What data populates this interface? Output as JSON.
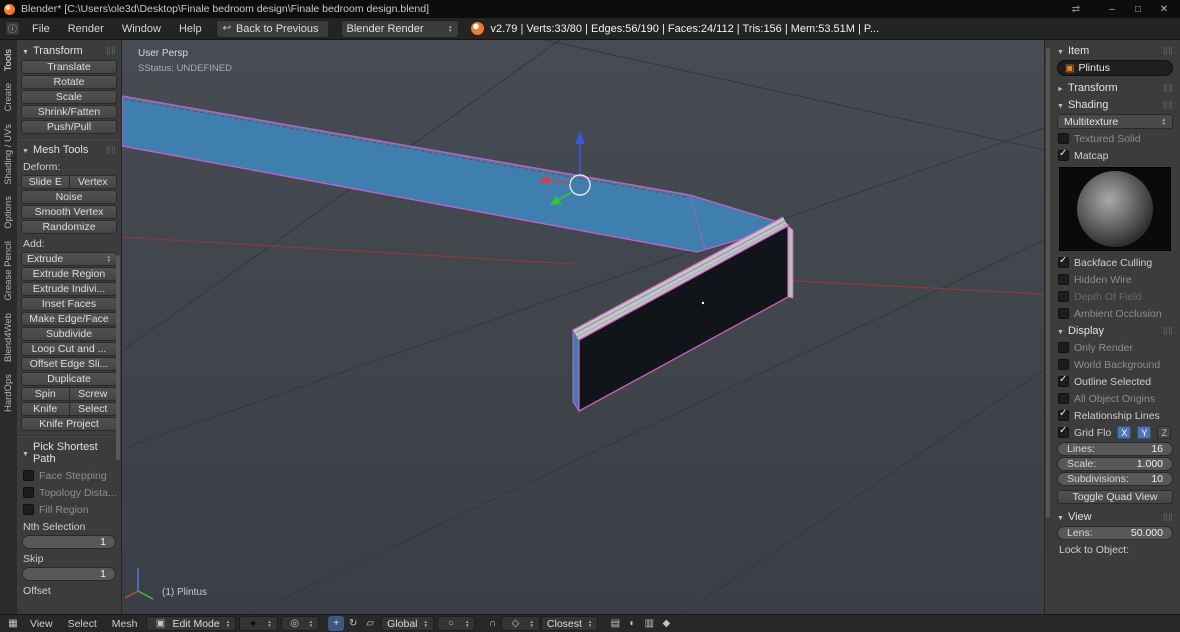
{
  "titlebar": {
    "title": "Blender* [C:\\Users\\ole3d\\Desktop\\Finale bedroom design\\Finale bedroom design.blend]",
    "window_icons": {
      "lang": "⇄",
      "minimize": "–",
      "maximize": "□",
      "close": "✕"
    }
  },
  "menubar": {
    "menus": [
      "File",
      "Render",
      "Window",
      "Help"
    ],
    "back_button": "Back to Previous",
    "engine": "Blender Render",
    "stats": "v2.79 | Verts:33/80 | Edges:56/190 | Faces:24/112 | Tris:156 | Mem:53.51M | P..."
  },
  "icons": {
    "info_editor": "ⓘ",
    "viewport_editor": "▦",
    "back": "↩",
    "mode_cube": "▣",
    "shading_sphere": "●",
    "pivot": "◎",
    "manip_translate": "+",
    "manip_rotate": "↻",
    "manip_scale": "▱",
    "proportional": "○",
    "snap_magnet": "∩",
    "snap_element": "◇",
    "render_a": "▤",
    "render_b": "◐",
    "render_c": "▥",
    "render_d": "◆",
    "object_cube": "▣"
  },
  "toolshelf": {
    "tabs": [
      "Tools",
      "Create",
      "Shading / UVs",
      "Options",
      "Grease Pencil",
      "Blend4Web",
      "HardOps"
    ],
    "transform": {
      "header": "Transform",
      "buttons": [
        "Translate",
        "Rotate",
        "Scale",
        "Shrink/Fatten",
        "Push/Pull"
      ]
    },
    "mesh_tools": {
      "header": "Mesh Tools",
      "deform_label": "Deform:",
      "pair1": [
        "Slide E",
        "Vertex"
      ],
      "buttons1": [
        "Noise",
        "Smooth Vertex",
        "Randomize"
      ],
      "add_label": "Add:",
      "extrude": "Extrude",
      "buttons2": [
        "Extrude Region",
        "Extrude Indivi...",
        "Inset Faces",
        "Make Edge/Face",
        "Subdivide",
        "Loop Cut and ...",
        "Offset Edge Sli...",
        "Duplicate"
      ],
      "pair2": [
        "Spin",
        "Screw"
      ],
      "pair3": [
        "Knife",
        "Select"
      ],
      "knife_project": "Knife Project"
    },
    "pick": {
      "header": "Pick Shortest Path",
      "checks": [
        "Face Stepping",
        "Topology Dista...",
        "Fill Region"
      ],
      "nth_label": "Nth Selection",
      "nth_value": "1",
      "skip_label": "Skip",
      "skip_value": "1",
      "offset_label": "Offset"
    }
  },
  "viewport": {
    "view_label": "User Persp",
    "status_label": "SStatus: UNDEFINED",
    "object_label": "(1) Plintus"
  },
  "npanel": {
    "item": {
      "header": "Item",
      "object_name": "Plintus"
    },
    "transform": {
      "header": "Transform"
    },
    "shading": {
      "header": "Shading",
      "mode": "Multitexture",
      "checks": [
        {
          "label": "Textured Solid",
          "checked": false
        },
        {
          "label": "Matcap",
          "checked": true
        },
        {
          "label": "Backface Culling",
          "checked": true
        },
        {
          "label": "Hidden Wire",
          "checked": false
        },
        {
          "label": "Depth Of Field",
          "checked": false
        },
        {
          "label": "Ambient Occlusion",
          "checked": false
        }
      ]
    },
    "display": {
      "header": "Display",
      "checks": [
        {
          "label": "Only Render",
          "checked": false
        },
        {
          "label": "World Background",
          "checked": false
        },
        {
          "label": "Outline Selected",
          "checked": true
        },
        {
          "label": "All Object Origins",
          "checked": false
        },
        {
          "label": "Relationship Lines",
          "checked": true
        },
        {
          "label": "Grid Flo",
          "checked": true
        }
      ],
      "axes": [
        "X",
        "Y",
        "Z"
      ],
      "fields": [
        {
          "label": "Lines:",
          "value": "16"
        },
        {
          "label": "Scale:",
          "value": "1.000"
        },
        {
          "label": "Subdivisions:",
          "value": "10"
        }
      ],
      "quad_button": "Toggle Quad View"
    },
    "view": {
      "header": "View",
      "lens_label": "Lens:",
      "lens_value": "50.000",
      "lock_label": "Lock to Object:"
    }
  },
  "bottombar": {
    "menus": [
      "View",
      "Select",
      "Mesh"
    ],
    "mode_label": "Edit Mode",
    "orientation_label": "Global",
    "snap_target_label": "Closest"
  }
}
